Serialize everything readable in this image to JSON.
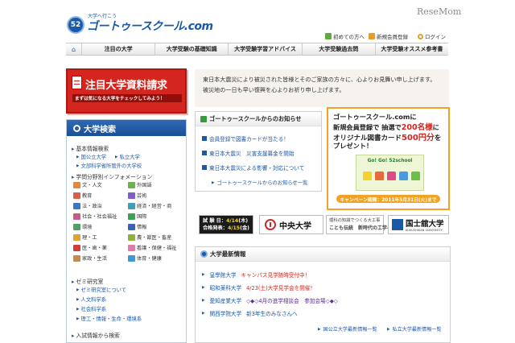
{
  "header": {
    "logo_badge": "52",
    "logo_tag": "大学へ行こう",
    "logo_text": "ゴートゥースクール.com",
    "publisher_logo": "ReseMom",
    "links": [
      {
        "label": "初めての方へ",
        "icon": "first-visit-icon"
      },
      {
        "label": "新規会員登録",
        "icon": "member-registration-icon"
      },
      {
        "label": "ログイン",
        "icon": "login-icon"
      }
    ]
  },
  "nav": {
    "home_icon": "home-icon",
    "items": [
      "注目の大学",
      "大学受験の基礎知識",
      "大学受験学習アドバイス",
      "大学受験過去問",
      "大学受験オススメ参考書"
    ]
  },
  "banner": {
    "title": "注目大学資料請求",
    "subtitle": "まずは気になる大学をチェックしてみよう！"
  },
  "condolence": {
    "text": "東日本大震災により被災された皆様とそのご家族の方々に、心よりお見舞い申し上げます。被災地の一日も早い復興を心よりお祈り申し上げます。"
  },
  "search": {
    "title": "大学検索",
    "sections": [
      {
        "label": "基本情報検索",
        "links": [
          "国公立大学",
          "私立大学",
          "文部科学省所管外の大学校"
        ]
      },
      {
        "label": "学問分野別インフォメーション"
      },
      {
        "label": "ゼミ研究室",
        "links": [
          "ゼミ研究室について",
          "人文科学系",
          "社会科学系",
          "理工・情報・生命・環境系"
        ]
      },
      {
        "label": "入試情報から検索"
      }
    ],
    "fields": [
      {
        "label": "文・人文",
        "color": "#e4873a"
      },
      {
        "label": "外国語",
        "color": "#6fb24a"
      },
      {
        "label": "教育",
        "color": "#d8604a"
      },
      {
        "label": "芸術",
        "color": "#7f5ec9"
      },
      {
        "label": "法・政治",
        "color": "#3a78c6"
      },
      {
        "label": "経済・経営・商",
        "color": "#3aa0b8"
      },
      {
        "label": "社会・社会福祉",
        "color": "#c95a8c"
      },
      {
        "label": "国際",
        "color": "#3aa05a"
      },
      {
        "label": "環境",
        "color": "#4ba35c"
      },
      {
        "label": "情報",
        "color": "#3a62b8"
      },
      {
        "label": "理・工",
        "color": "#e0a232"
      },
      {
        "label": "農・獣医・畜産",
        "color": "#8db33a"
      },
      {
        "label": "医・歯・薬",
        "color": "#d23e3e"
      },
      {
        "label": "看護・保健・福祉",
        "color": "#e27ba8"
      },
      {
        "label": "家政・生活",
        "color": "#c78b4a"
      },
      {
        "label": "体育・健康",
        "color": "#3a9ad4"
      }
    ]
  },
  "notice": {
    "title": "ゴートゥースクールからのお知らせ",
    "items": [
      "会員登録で図書カードが当たる！",
      "東日本大震災　災害支援募金を開始",
      "東日本大震災による影響・対応について"
    ],
    "more": "ゴートゥースクールからのお知らせ一覧"
  },
  "promo": {
    "line1": "ゴートゥースクール.comに",
    "line2_a": "新規会員登録で 抽選で",
    "line2_em": "200名様",
    "line2_b": "に",
    "line3_a": "オリジナル図書カード",
    "line3_em": "500円分",
    "line3_b": "を",
    "line4": "プレゼント！",
    "card_text": "Go! Go! 52school",
    "campaign": "キャンペーン期間：2011年5月31日(火)まで",
    "shirt_colors": [
      "#f2d22c",
      "#e86a3a",
      "#e04a8a",
      "#4a9ae0",
      "#6cc04a"
    ]
  },
  "ads": {
    "exam_l1_label": "試 験 日：",
    "exam_l1_date": "4/14",
    "exam_l1_day": "(木)",
    "exam_l2_label": "合格発表：",
    "exam_l2_date": "4/15",
    "exam_l2_day": "(金)",
    "chuo": "中央大学",
    "work_top": "理科の知識でつくる大工事",
    "work_bottom": "ことも伝統　新時代の工学へ",
    "kokushikan_main": "国士舘大学",
    "kokushikan_sub": "KOKUSHIKAN UNIVERSITY"
  },
  "news": {
    "title": "大学最新情報",
    "items": [
      {
        "univ": "皇學館大学",
        "title": "キャンパス見学随時受付中！",
        "style": "red"
      },
      {
        "univ": "昭和薬科大学",
        "title": "4/23(土)大学見学会を開催！",
        "style": "red"
      },
      {
        "univ": "愛知産業大学",
        "title": "◇◆◇4月の進学相談会　参加会場◇◆◇",
        "style": "purple"
      },
      {
        "univ": "関西学院大学",
        "title": "新3年生のみなさんへ",
        "style": "blue"
      }
    ],
    "footer_links": [
      "国公立大学最新情報一覧",
      "私立大学最新情報一覧"
    ]
  }
}
